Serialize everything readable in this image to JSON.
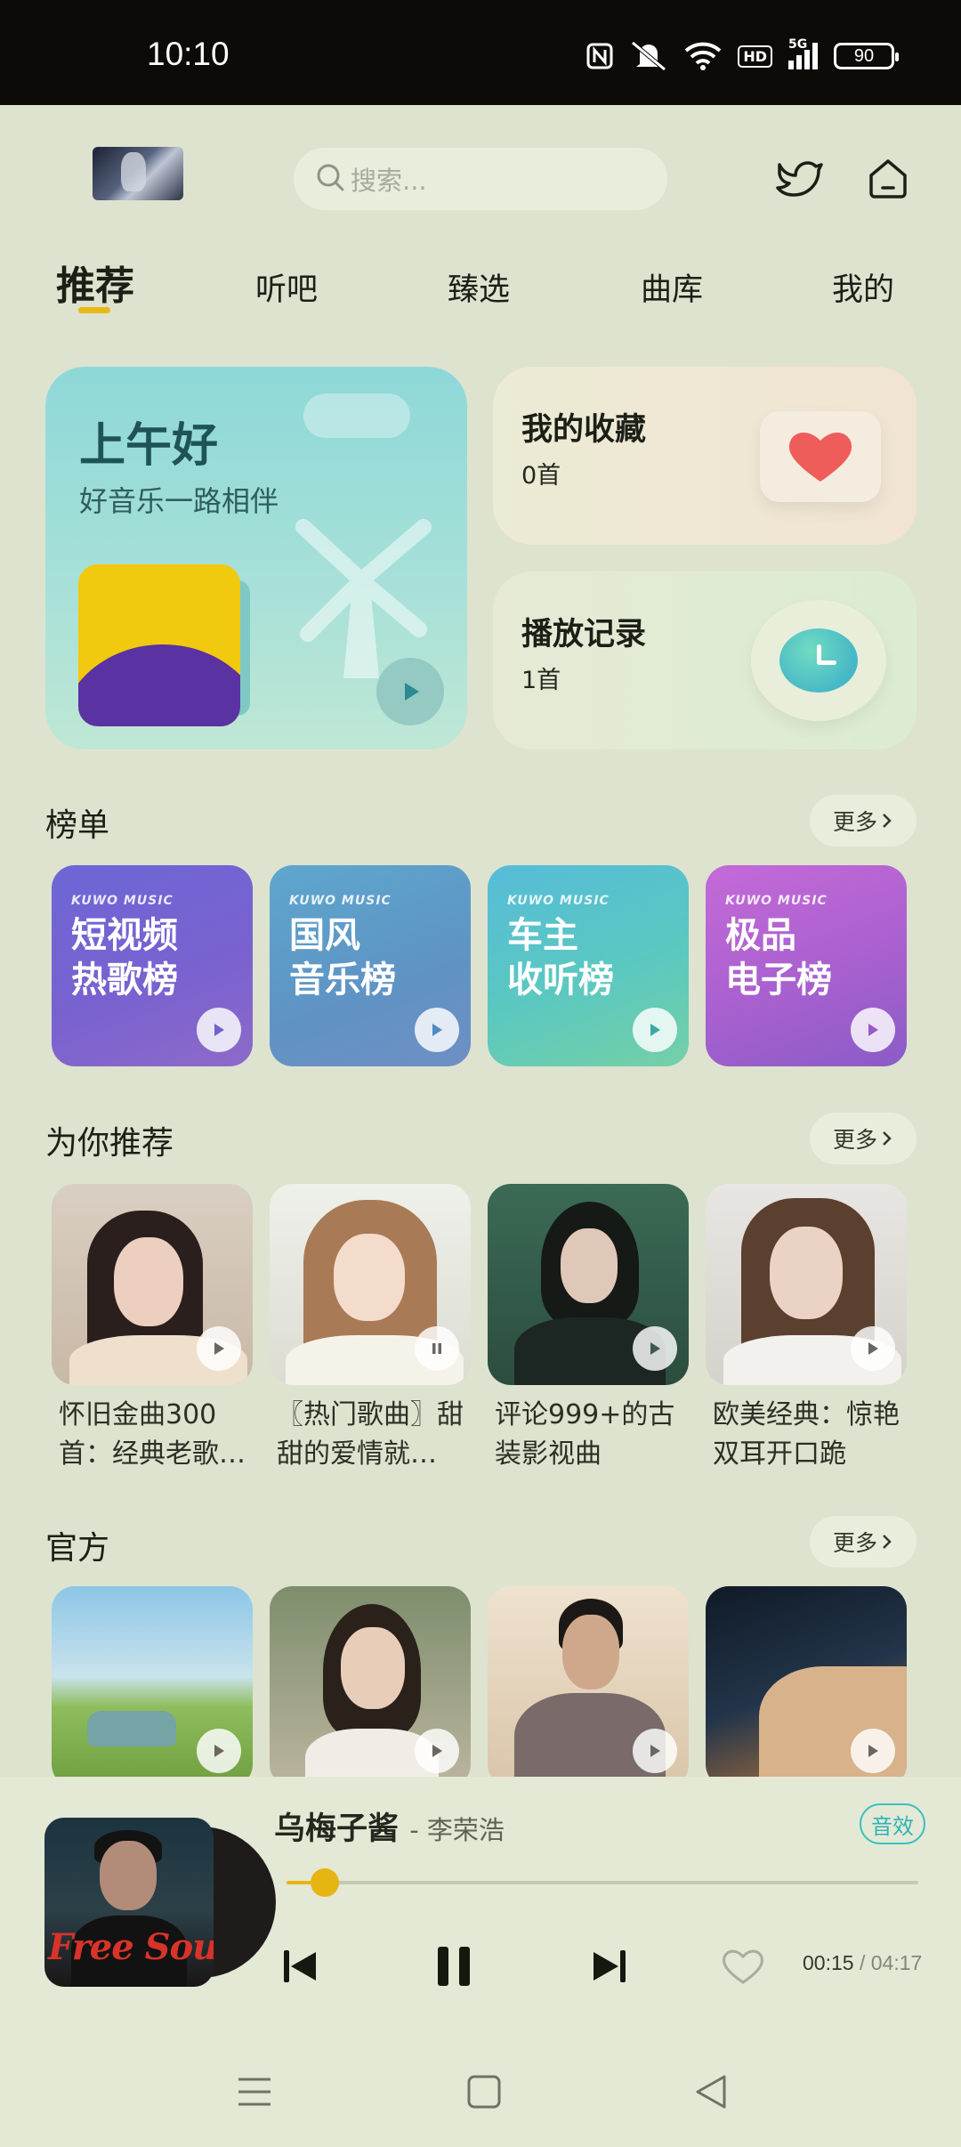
{
  "status_bar": {
    "time": "10:10",
    "battery": "90",
    "hd": "HD",
    "net": "5G"
  },
  "search": {
    "placeholder": "搜索..."
  },
  "tabs": [
    {
      "label": "推荐",
      "active": true
    },
    {
      "label": "听吧",
      "active": false
    },
    {
      "label": "臻选",
      "active": false
    },
    {
      "label": "曲库",
      "active": false
    },
    {
      "label": "我的",
      "active": false
    }
  ],
  "greeting": {
    "title": "上午好",
    "subtitle": "好音乐一路相伴"
  },
  "favorites": {
    "title": "我的收藏",
    "count": "0首"
  },
  "history": {
    "title": "播放记录",
    "count": "1首"
  },
  "charts_section": {
    "title": "榜单",
    "more": "更多",
    "items": [
      {
        "brand": "KUWO MUSIC",
        "label": "短视频\n热歌榜"
      },
      {
        "brand": "KUWO MUSIC",
        "label": "国风\n音乐榜"
      },
      {
        "brand": "KUWO MUSIC",
        "label": "车主\n收听榜"
      },
      {
        "brand": "KUWO MUSIC",
        "label": "极品\n电子榜"
      }
    ]
  },
  "recommend_section": {
    "title": "为你推荐",
    "more": "更多",
    "items": [
      {
        "label": "怀旧金曲300首：经典老歌…"
      },
      {
        "label": "〖热门歌曲〗甜甜的爱情就…"
      },
      {
        "label": "评论999+的古装影视曲"
      },
      {
        "label": "欧美经典：惊艳双耳开口跪"
      }
    ]
  },
  "official_section": {
    "title": "官方",
    "more": "更多"
  },
  "player": {
    "song": "乌梅子酱",
    "artist": "- 李荣浩",
    "effect": "音效",
    "cover_text": "Free Soul",
    "current_time": "00:15",
    "total_time": "/ 04:17",
    "progress": 0.06
  },
  "colors": {
    "accent": "#e7b512",
    "effect": "#2cb3b6",
    "background": "#dde3cf"
  }
}
